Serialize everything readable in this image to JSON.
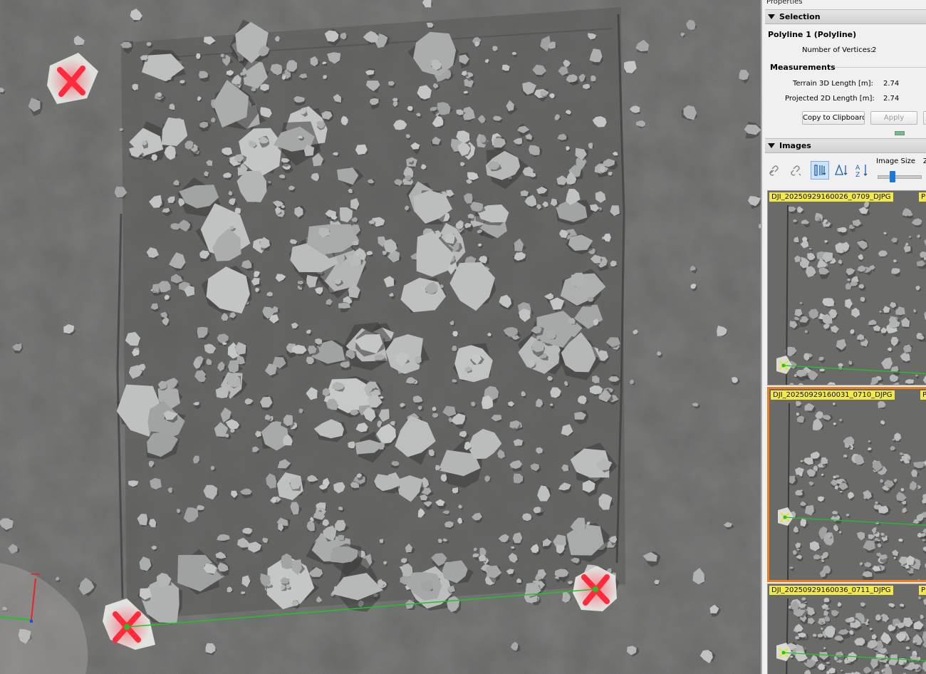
{
  "panel": {
    "title": "Properties",
    "selection": {
      "header": "Selection",
      "object_name": "Polyline 1 (Polyline)",
      "vertices_label": "Number of Vertices:",
      "vertices_value": "2",
      "measurements_header": "Measurements",
      "terrain_label": "Terrain 3D Length [m]:",
      "terrain_value": "2.74",
      "projected_label": "Projected 2D Length [m]:",
      "projected_value": "2.74",
      "copy_button": "Copy to Clipboard",
      "apply_button": "Apply"
    },
    "images": {
      "header": "Images",
      "image_size_label": "Image Size",
      "image_size_truncated": "Z",
      "thumbnails": [
        {
          "name": "DJI_20250929160026_0709_DJPG",
          "side_label": "P",
          "selected": false
        },
        {
          "name": "DJI_20250929160031_0710_DJPG",
          "side_label": "P",
          "selected": true
        },
        {
          "name": "DJI_20250929160036_0711_DJPG",
          "side_label": "P",
          "selected": false
        }
      ]
    }
  },
  "colors": {
    "polyline": "#22c22a",
    "marker": "#ff2a3c",
    "selected_border": "#f07c1c",
    "label_bg": "#f1e84c",
    "accent": "#1979d8"
  },
  "icons": [
    "link-icon",
    "unlink-icon",
    "sort-distance-icon",
    "sort-angle-icon",
    "sort-alpha-icon",
    "axis-gizmo-icon"
  ]
}
